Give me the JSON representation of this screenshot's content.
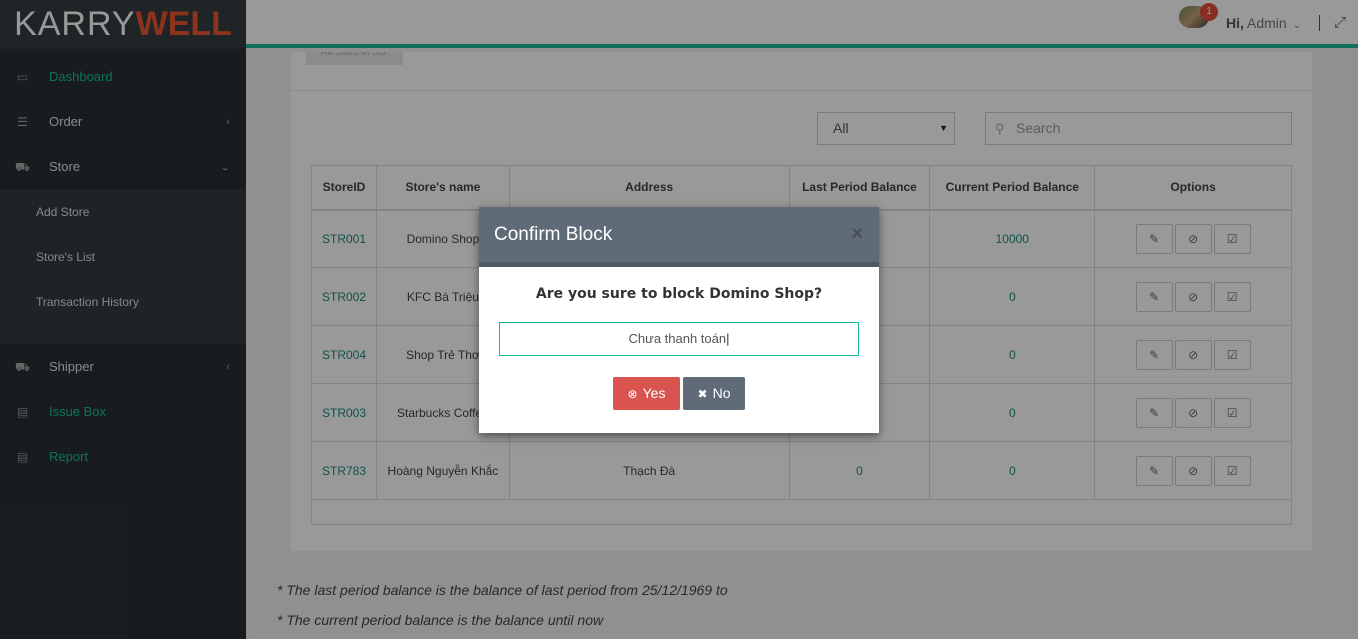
{
  "brand": {
    "part1": "KARRY",
    "part2": "WELL"
  },
  "sidebar": {
    "items": [
      {
        "label": "Dashboard",
        "icon": "laptop-icon"
      },
      {
        "label": "Order",
        "icon": "list-icon"
      },
      {
        "label": "Store",
        "icon": "cart-icon"
      },
      {
        "label": "Shipper",
        "icon": "truck-icon"
      },
      {
        "label": "Issue Box",
        "icon": "book-icon"
      },
      {
        "label": "Report",
        "icon": "book-icon"
      }
    ],
    "store_submenu": [
      "Add Store",
      "Store's List",
      "Transaction History"
    ]
  },
  "header": {
    "notification_count": "1",
    "greeting_hi": "Hi,",
    "greeting_name": "Admin"
  },
  "panel": {
    "tab_label": "All Store in SS",
    "filter_value": "All",
    "search_placeholder": "Search"
  },
  "table": {
    "headers": [
      "StoreID",
      "Store's name",
      "Address",
      "Last Period Balance",
      "Current Period Balance",
      "Options"
    ],
    "rows": [
      {
        "id": "STR001",
        "name": "Domino Shop",
        "address": "",
        "last": "",
        "current": "10000"
      },
      {
        "id": "STR002",
        "name": "KFC Bà Triệu",
        "address": "",
        "last": "",
        "current": "0"
      },
      {
        "id": "STR004",
        "name": "Shop Trẻ Thơ",
        "address": "",
        "last": "",
        "current": "0"
      },
      {
        "id": "STR003",
        "name": "Starbucks Coffee",
        "address": "",
        "last": "",
        "current": "0"
      },
      {
        "id": "STR783",
        "name": "Hoàng Nguyễn Khắc",
        "address": "Thạch Đà",
        "last": "0",
        "current": "0"
      }
    ]
  },
  "notes": {
    "last_period": "* The last period balance is the balance of last period from 25/12/1969 to",
    "current_period": "* The current period balance is the balance until now"
  },
  "modal": {
    "title": "Confirm Block",
    "question": "Are you sure to block Domino Shop?",
    "reason_value": "Chưa thanh toán",
    "yes_label": "Yes",
    "no_label": "No"
  },
  "colors": {
    "accent": "#1abc9c",
    "danger": "#d9534f",
    "modal_header": "#5f6b77"
  }
}
